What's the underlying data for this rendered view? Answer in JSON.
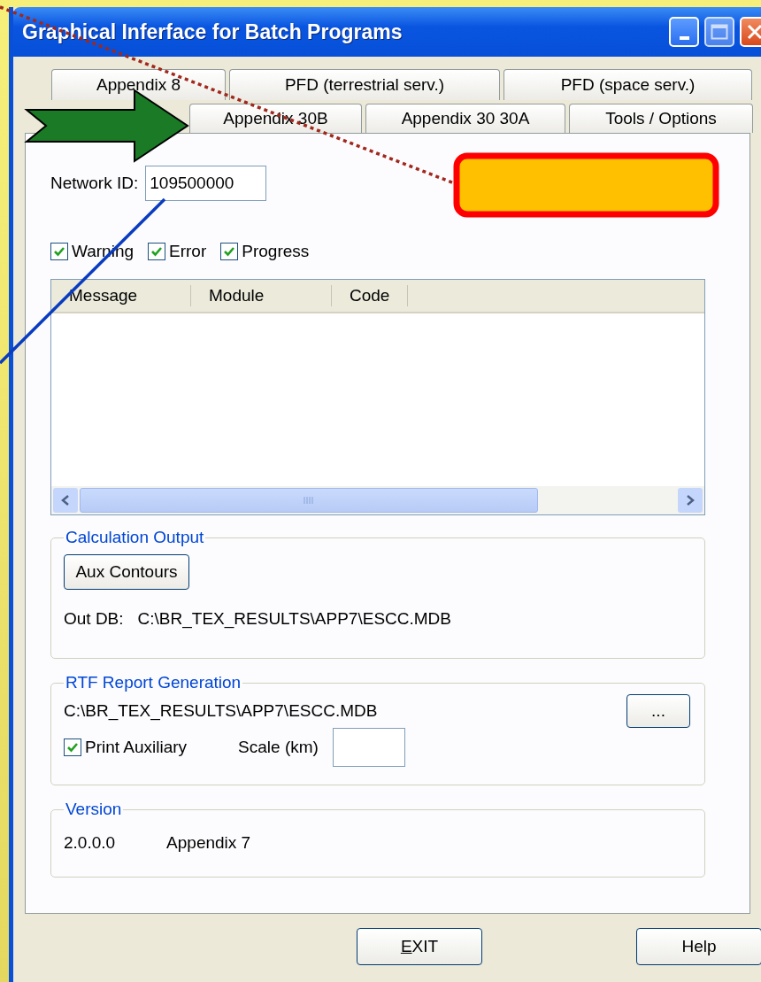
{
  "window": {
    "title": "Graphical Inferface for Batch Programs"
  },
  "back_tabs": [
    {
      "label": "Appendix 8",
      "selected": false
    },
    {
      "label": "PFD (terrestrial serv.)",
      "selected": false
    },
    {
      "label": "PFD (space serv.)",
      "selected": false
    }
  ],
  "front_tabs": [
    {
      "label": "Appendix 30B",
      "selected": false
    },
    {
      "label": "Appendix 30 30A",
      "selected": false
    },
    {
      "label": "Tools / Options",
      "selected": false
    }
  ],
  "network_id": {
    "label": "Network ID:",
    "value": "109500000"
  },
  "filters": [
    {
      "label": "Warning",
      "checked": true
    },
    {
      "label": "Error",
      "checked": true
    },
    {
      "label": "Progress",
      "checked": true
    }
  ],
  "message_table": {
    "columns": [
      "Message",
      "Module",
      "Code"
    ]
  },
  "calculation_output": {
    "title": "Calculation Output",
    "button": "Aux Contours",
    "out_db_label": "Out DB:",
    "out_db_path": "C:\\BR_TEX_RESULTS\\APP7\\ESCC.MDB"
  },
  "rtf_report": {
    "title": "RTF Report Generation",
    "path": "C:\\BR_TEX_RESULTS\\APP7\\ESCC.MDB",
    "browse_button": "...",
    "print_auxiliary": {
      "label": "Print Auxiliary",
      "checked": true
    },
    "scale_label": "Scale (km)"
  },
  "version": {
    "title": "Version",
    "number": "2.0.0.0",
    "name": "Appendix 7"
  },
  "buttons": [
    {
      "accel": "E",
      "rest": "XIT"
    },
    {
      "rest": "Help"
    }
  ]
}
